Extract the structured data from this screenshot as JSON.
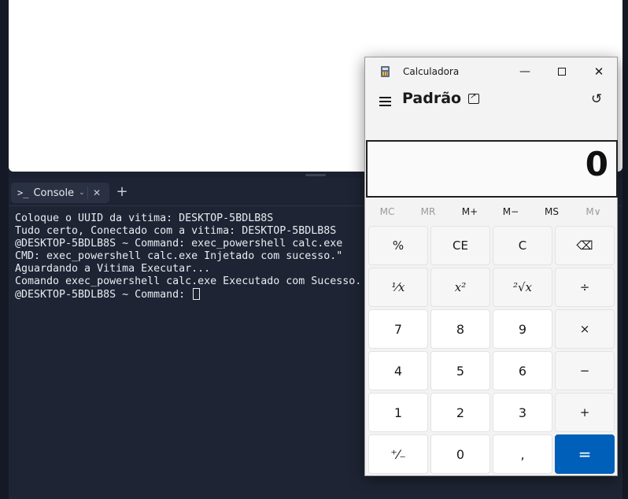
{
  "console": {
    "tab_prompt": ">_",
    "tab_label": "Console",
    "lines": [
      "Coloque o UUID da vitima: DESKTOP-5BDLB8S",
      "Tudo certo, Conectado com a vitima: DESKTOP-5BDLB8S",
      "@DESKTOP-5BDLB8S ~ Command: exec_powershell calc.exe",
      "CMD: exec_powershell calc.exe Injetado com sucesso.\"",
      "Aguardando a Vitima Executar...",
      "Comando exec_powershell calc.exe Executado com Sucesso."
    ],
    "prompt": "@DESKTOP-5BDLB8S ~ Command: "
  },
  "calculator": {
    "window_title": "Calculadora",
    "mode": "Padrão",
    "display": "0",
    "memory": [
      "MC",
      "MR",
      "M+",
      "M−",
      "MS",
      "M∨"
    ],
    "keys": [
      [
        "%",
        "CE",
        "C",
        "⌫"
      ],
      [
        "¹⁄x",
        "x²",
        "²√x",
        "÷"
      ],
      [
        "7",
        "8",
        "9",
        "×"
      ],
      [
        "4",
        "5",
        "6",
        "−"
      ],
      [
        "1",
        "2",
        "3",
        "+"
      ],
      [
        "⁺⁄₋",
        "0",
        ",",
        "="
      ]
    ]
  }
}
